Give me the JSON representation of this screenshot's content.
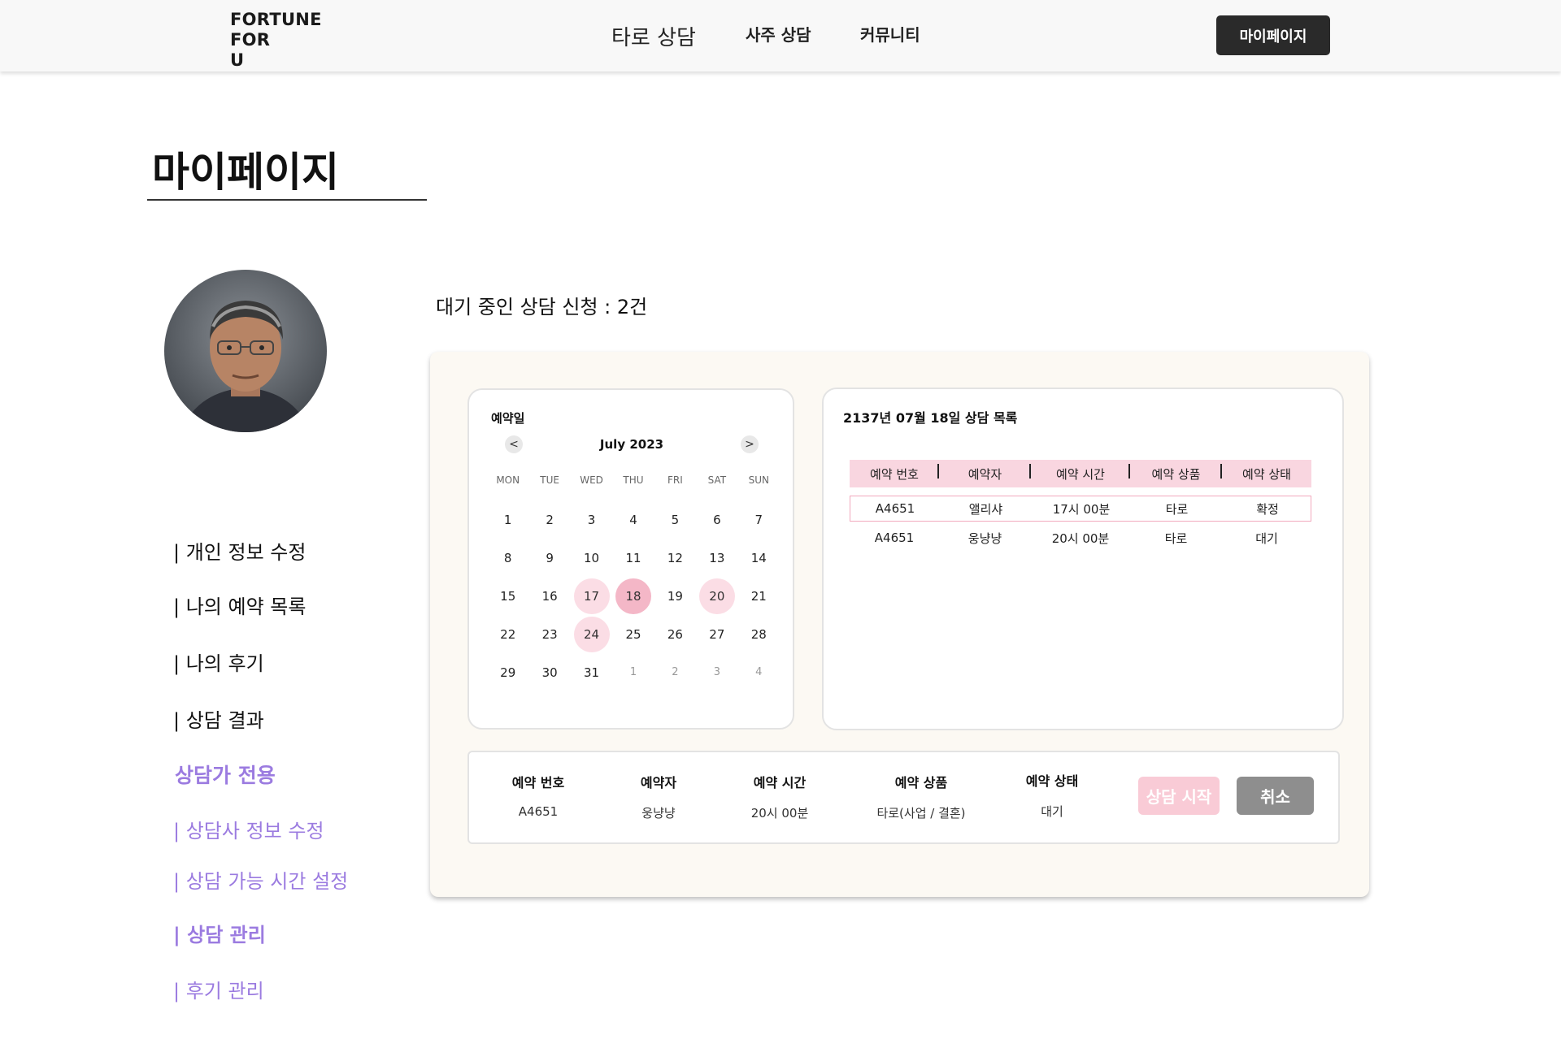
{
  "header": {
    "logo": [
      "FORTUNE",
      "FOR",
      "U"
    ],
    "nav": {
      "tarot": "타로 상담",
      "saju": "사주 상담",
      "community": "커뮤니티"
    },
    "mypage_button": "마이페이지"
  },
  "page_title": "마이페이지",
  "sidebar": {
    "items": [
      {
        "label": "| 개인 정보 수정"
      },
      {
        "label": "| 나의 예약 목록"
      },
      {
        "label": "| 나의 후기"
      },
      {
        "label": "| 상담 결과"
      }
    ],
    "counselor_heading": "상담가 전용",
    "counselor_items": [
      {
        "label": "| 상담사 정보 수정"
      },
      {
        "label": "| 상담 가능 시간 설정"
      },
      {
        "label": "| 상담 관리"
      },
      {
        "label": "| 후기 관리"
      }
    ]
  },
  "pending_text": "대기 중인 상담 신청 : 2건",
  "calendar": {
    "label": "예약일",
    "prev": "<",
    "next": ">",
    "month": "July 2023",
    "weekdays": [
      "MON",
      "TUE",
      "WED",
      "THU",
      "FRI",
      "SAT",
      "SUN"
    ],
    "days": [
      {
        "d": "1"
      },
      {
        "d": "2"
      },
      {
        "d": "3"
      },
      {
        "d": "4"
      },
      {
        "d": "5"
      },
      {
        "d": "6"
      },
      {
        "d": "7"
      },
      {
        "d": "8"
      },
      {
        "d": "9"
      },
      {
        "d": "10"
      },
      {
        "d": "11"
      },
      {
        "d": "12"
      },
      {
        "d": "13"
      },
      {
        "d": "14"
      },
      {
        "d": "15"
      },
      {
        "d": "16"
      },
      {
        "d": "17",
        "mark": "light"
      },
      {
        "d": "18",
        "mark": "strong"
      },
      {
        "d": "19"
      },
      {
        "d": "20",
        "mark": "light"
      },
      {
        "d": "21"
      },
      {
        "d": "22"
      },
      {
        "d": "23"
      },
      {
        "d": "24",
        "mark": "light"
      },
      {
        "d": "25"
      },
      {
        "d": "26"
      },
      {
        "d": "27"
      },
      {
        "d": "28"
      },
      {
        "d": "29"
      },
      {
        "d": "30"
      },
      {
        "d": "31"
      },
      {
        "d": "1",
        "muted": true
      },
      {
        "d": "2",
        "muted": true
      },
      {
        "d": "3",
        "muted": true
      },
      {
        "d": "4",
        "muted": true
      }
    ],
    "colors": {
      "light": "#fbdde5",
      "strong": "#f4b7c7"
    }
  },
  "list": {
    "title": "2137년 07월 18일 상담 목록",
    "headers": [
      "예약 번호",
      "예약자",
      "예약 시간",
      "예약 상품",
      "예약 상태"
    ],
    "rows": [
      [
        "A4651",
        "앨리샤",
        "17시 00분",
        "타로",
        "확정"
      ],
      [
        "A4651",
        "웅냥냥",
        "20시 00분",
        "타로",
        "대기"
      ]
    ]
  },
  "detail": {
    "headers": [
      "예약 번호",
      "예약자",
      "예약 시간",
      "예약 상품",
      "예약 상태"
    ],
    "values": [
      "A4651",
      "웅냥냥",
      "20시 00분",
      "타로(사업 / 결혼)",
      "대기"
    ],
    "start_button": "상담 시작",
    "cancel_button": "취소"
  },
  "accent_colors": {
    "purple": "#9b7be0",
    "pink": "#f9d6e0",
    "dark": "#2a2a2a"
  }
}
